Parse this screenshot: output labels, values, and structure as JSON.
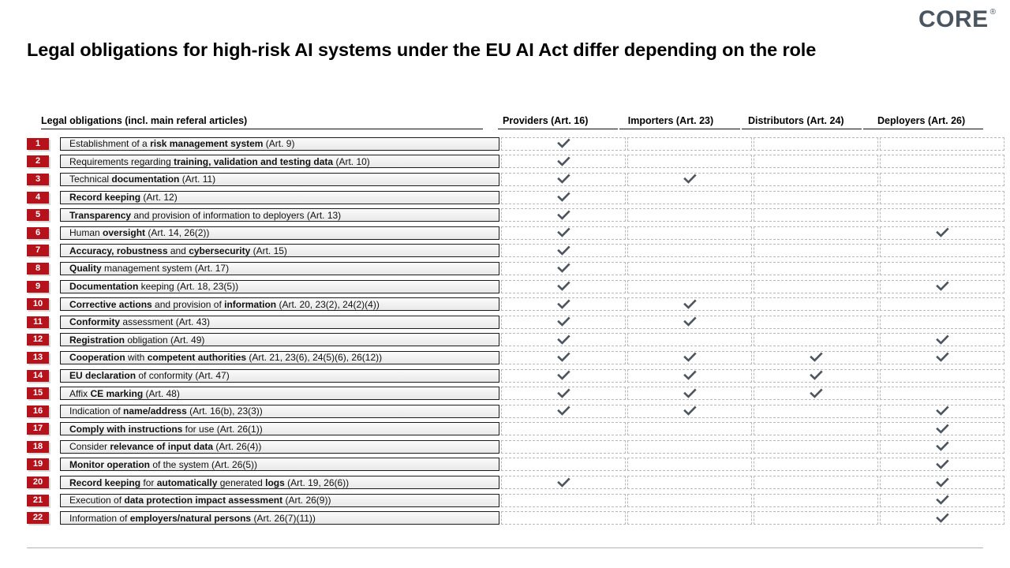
{
  "logo": {
    "text": "CORE",
    "registered_mark": "®",
    "color": "#4a5560"
  },
  "title": "Legal obligations for high-risk AI systems under the EU AI Act differ depending on the role",
  "table": {
    "obligations_header": "Legal obligations (incl. main referal articles)",
    "role_columns": [
      {
        "label": "Providers (Art. 16)",
        "key": "providers"
      },
      {
        "label": "Importers (Art. 23)",
        "key": "importers"
      },
      {
        "label": "Distributors (Art. 24)",
        "key": "distributors"
      },
      {
        "label": "Deployers (Art. 26)",
        "key": "deployers"
      }
    ],
    "check_glyph": "✔",
    "badge_color": "#b5121b",
    "check_color": "#4d5660",
    "rows": [
      {
        "number": "1",
        "label_html": "Establishment of a <b>risk management system</b> (Art. 9)",
        "checks": [
          true,
          false,
          false,
          false
        ]
      },
      {
        "number": "2",
        "label_html": "Requirements regarding <b>training, validation and testing data</b> (Art. 10)",
        "checks": [
          true,
          false,
          false,
          false
        ]
      },
      {
        "number": "3",
        "label_html": "Technical <b>documentation</b> (Art. 11)",
        "checks": [
          true,
          true,
          false,
          false
        ]
      },
      {
        "number": "4",
        "label_html": "<b>Record keeping</b> (Art. 12)",
        "checks": [
          true,
          false,
          false,
          false
        ]
      },
      {
        "number": "5",
        "label_html": "<b>Transparency</b> and provision of information to deployers (Art. 13)",
        "checks": [
          true,
          false,
          false,
          false
        ]
      },
      {
        "number": "6",
        "label_html": "Human <b>oversight</b> (Art. 14, 26(2))",
        "checks": [
          true,
          false,
          false,
          true
        ]
      },
      {
        "number": "7",
        "label_html": "<b>Accuracy, robustness</b> and <b>cybersecurity</b> (Art. 15)",
        "checks": [
          true,
          false,
          false,
          false
        ]
      },
      {
        "number": "8",
        "label_html": "<b>Quality</b> management system (Art. 17)",
        "checks": [
          true,
          false,
          false,
          false
        ]
      },
      {
        "number": "9",
        "label_html": "<b>Documentation</b> keeping (Art. 18, 23(5))",
        "checks": [
          true,
          false,
          false,
          true
        ]
      },
      {
        "number": "10",
        "label_html": "<b>Corrective actions</b> and provision of <b>information</b> (Art. 20, 23(2), 24(2)(4))",
        "checks": [
          true,
          true,
          false,
          false
        ]
      },
      {
        "number": "11",
        "label_html": "<b>Conformity</b> assessment (Art. 43)",
        "checks": [
          true,
          true,
          false,
          false
        ]
      },
      {
        "number": "12",
        "label_html": "<b>Registration</b> obligation (Art. 49)",
        "checks": [
          true,
          false,
          false,
          true
        ]
      },
      {
        "number": "13",
        "label_html": "<b>Cooperation</b> with <b>competent authorities</b> (Art. 21, 23(6), 24(5)(6), 26(12))",
        "checks": [
          true,
          true,
          true,
          true
        ]
      },
      {
        "number": "14",
        "label_html": "<b>EU declaration</b> of conformity (Art. 47)",
        "checks": [
          true,
          true,
          true,
          false
        ]
      },
      {
        "number": "15",
        "label_html": "Affix <b>CE marking</b> (Art. 48)",
        "checks": [
          true,
          true,
          true,
          false
        ]
      },
      {
        "number": "16",
        "label_html": "Indication of <b>name/address</b> (Art. 16(b), 23(3))",
        "checks": [
          true,
          true,
          false,
          true
        ]
      },
      {
        "number": "17",
        "label_html": "<b>Comply with instructions</b> for use (Art. 26(1))",
        "checks": [
          false,
          false,
          false,
          true
        ]
      },
      {
        "number": "18",
        "label_html": "Consider <b>relevance of input data</b> (Art. 26(4))",
        "checks": [
          false,
          false,
          false,
          true
        ]
      },
      {
        "number": "19",
        "label_html": "<b>Monitor operation</b> of the system (Art. 26(5))",
        "checks": [
          false,
          false,
          false,
          true
        ]
      },
      {
        "number": "20",
        "label_html": "<b>Record keeping</b> for <b>automatically</b> generated <b>logs</b> (Art. 19, 26(6))",
        "checks": [
          true,
          false,
          false,
          true
        ]
      },
      {
        "number": "21",
        "label_html": "Execution of <b>data protection impact assessment</b> (Art. 26(9))",
        "checks": [
          false,
          false,
          false,
          true
        ]
      },
      {
        "number": "22",
        "label_html": "Information of <b>employers/natural persons</b> (Art. 26(7)(11))",
        "checks": [
          false,
          false,
          false,
          true
        ]
      }
    ]
  }
}
